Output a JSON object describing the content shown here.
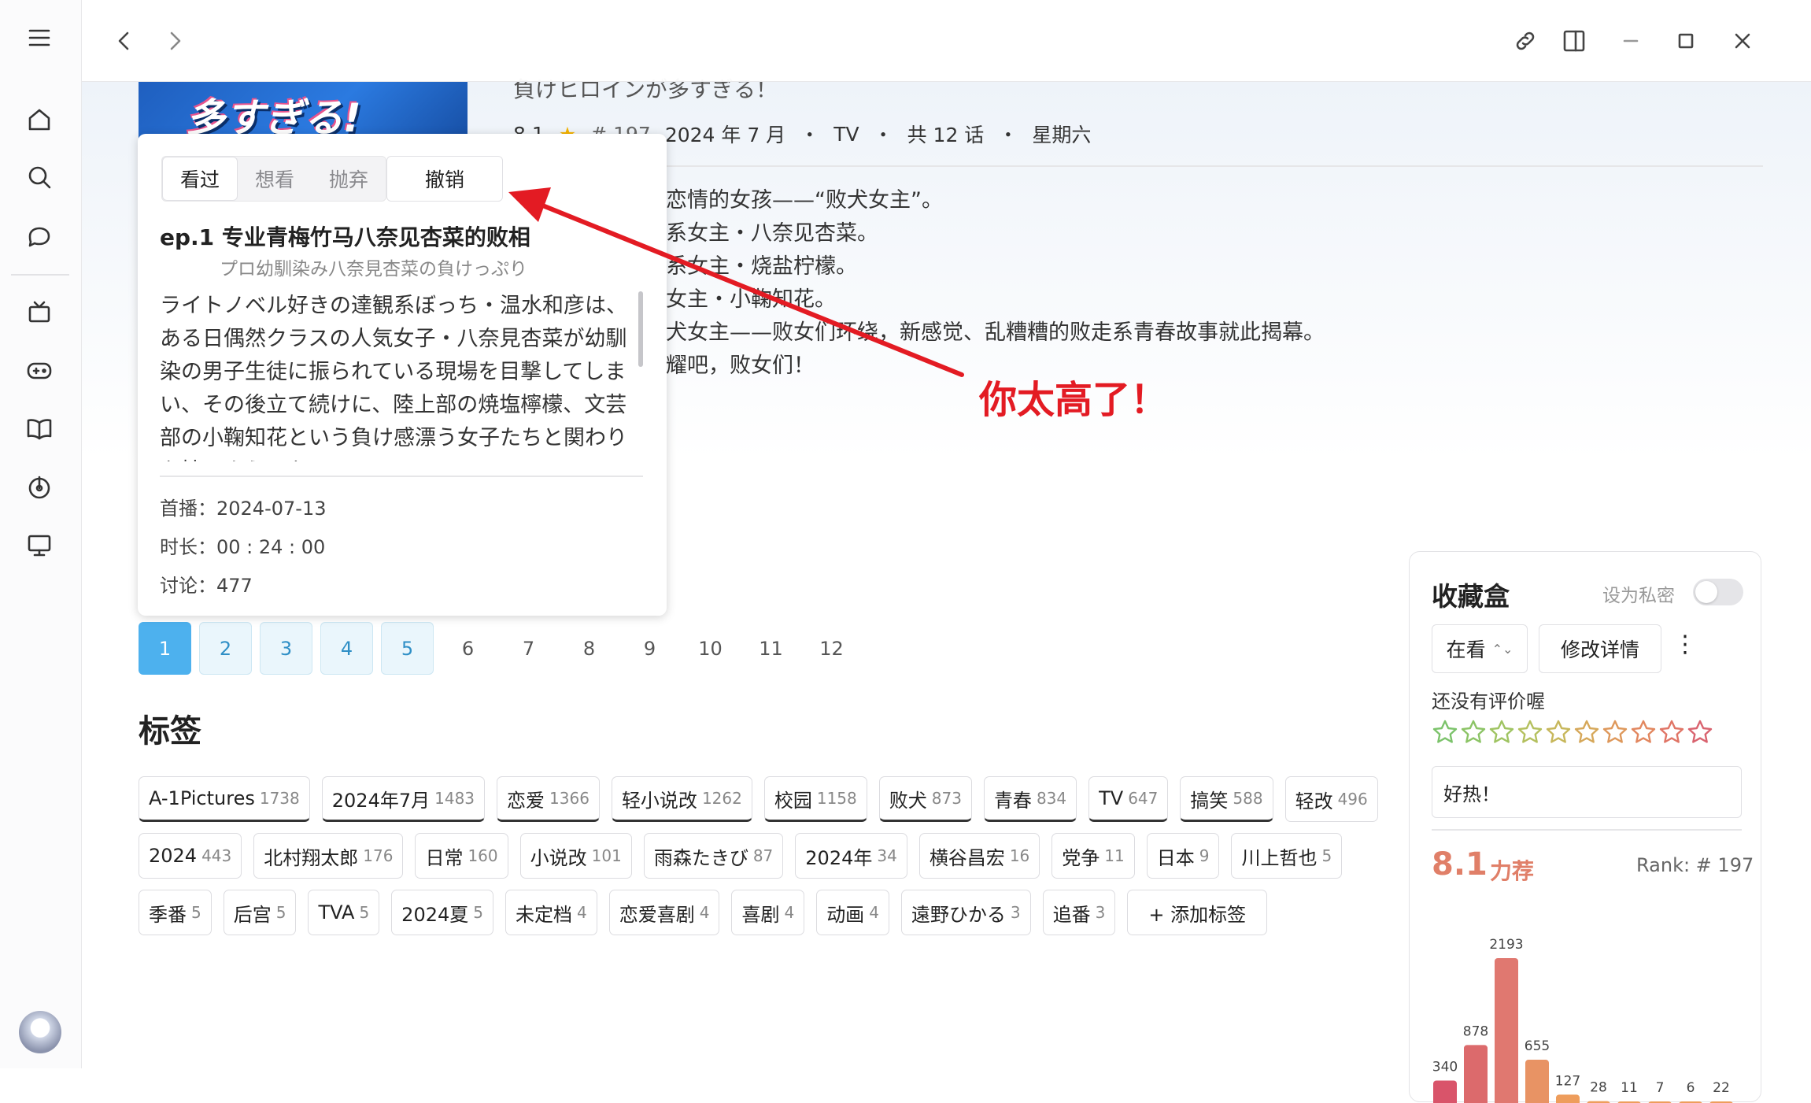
{
  "hero": {
    "title_cut": "負けヒロインが多すぎる！",
    "cover_text": "多すぎる!",
    "score": "8.1",
    "rank": "# 197",
    "meta": [
      "2024 年 7 月",
      "・",
      "TV",
      "・",
      "共 12 话",
      "・",
      "星期六"
    ]
  },
  "summary_lines": [
    "恋情的女孩——“败犬女主”。",
    "系女主・八奈见杏菜。",
    "系女主・烧盐柠檬。",
    "女主・小鞠知花。",
    "犬女主——败女们环绕，新感觉、乱糟糟的败走系青春故事就此揭幕。",
    "耀吧，败女们！"
  ],
  "popup": {
    "tabs": [
      "看过",
      "想看",
      "抛弃"
    ],
    "cancel": "撤销",
    "ep_title": "ep.1  专业青梅竹马八奈见杏菜的败相",
    "ep_subtitle": "プロ幼馴染み八奈見杏菜の負けっぷり",
    "ep_desc": "ライトノベル好きの達観系ぼっち・温水和彦は、ある日偶然クラスの人気女子・八奈見杏菜が幼馴染の男子生徒に振られている現場を目撃してしまい、その後立て続けに、陸上部の焼塩檸檬、文芸部の小鞠知花という負け感漂う女子たちと関わりを持つようになる。",
    "air_label": "首播：",
    "air_date": "2024-07-13",
    "duration_label": "时长：",
    "duration": "00 : 24 : 00",
    "discuss_label": "讨论：",
    "discuss": "477"
  },
  "pager": [
    {
      "label": "1",
      "state": "current"
    },
    {
      "label": "2",
      "state": "watched"
    },
    {
      "label": "3",
      "state": "watched"
    },
    {
      "label": "4",
      "state": "watched"
    },
    {
      "label": "5",
      "state": "watched"
    },
    {
      "label": "6",
      "state": "none"
    },
    {
      "label": "7",
      "state": "none"
    },
    {
      "label": "8",
      "state": "none"
    },
    {
      "label": "9",
      "state": "none"
    },
    {
      "label": "10",
      "state": "none"
    },
    {
      "label": "11",
      "state": "none"
    },
    {
      "label": "12",
      "state": "none"
    }
  ],
  "tags_title": "标签",
  "tags": [
    {
      "name": "A-1Pictures",
      "count": "1738",
      "hot": true
    },
    {
      "name": "2024年7月",
      "count": "1483",
      "hot": true
    },
    {
      "name": "恋爱",
      "count": "1366",
      "hot": true
    },
    {
      "name": "轻小说改",
      "count": "1262",
      "hot": true
    },
    {
      "name": "校园",
      "count": "1158",
      "hot": true
    },
    {
      "name": "败犬",
      "count": "873",
      "hot": true
    },
    {
      "name": "青春",
      "count": "834",
      "hot": true
    },
    {
      "name": "TV",
      "count": "647",
      "hot": true
    },
    {
      "name": "搞笑",
      "count": "588",
      "hot": true
    },
    {
      "name": "轻改",
      "count": "496",
      "hot": false
    },
    {
      "name": "2024",
      "count": "443",
      "hot": false
    },
    {
      "name": "北村翔太郎",
      "count": "176",
      "hot": false
    },
    {
      "name": "日常",
      "count": "160",
      "hot": false
    },
    {
      "name": "小说改",
      "count": "101",
      "hot": false
    },
    {
      "name": "雨森たきび",
      "count": "87",
      "hot": false
    },
    {
      "name": "2024年",
      "count": "34",
      "hot": false
    },
    {
      "name": "横谷昌宏",
      "count": "16",
      "hot": false
    },
    {
      "name": "党争",
      "count": "11",
      "hot": false
    },
    {
      "name": "日本",
      "count": "9",
      "hot": false
    },
    {
      "name": "川上哲也",
      "count": "5",
      "hot": false
    },
    {
      "name": "季番",
      "count": "5",
      "hot": false
    },
    {
      "name": "后宫",
      "count": "5",
      "hot": false
    },
    {
      "name": "TVA",
      "count": "5",
      "hot": false
    },
    {
      "name": "2024夏",
      "count": "5",
      "hot": false
    },
    {
      "name": "未定档",
      "count": "4",
      "hot": false
    },
    {
      "name": "恋爱喜剧",
      "count": "4",
      "hot": false
    },
    {
      "name": "喜剧",
      "count": "4",
      "hot": false
    },
    {
      "name": "动画",
      "count": "4",
      "hot": false
    },
    {
      "name": "遠野ひかる",
      "count": "3",
      "hot": false
    },
    {
      "name": "追番",
      "count": "3",
      "hot": false
    }
  ],
  "add_tag": "+ 添加标签",
  "collection": {
    "title": "收藏盒",
    "private_label": "设为私密",
    "status": "在看",
    "edit": "修改详情",
    "more": "⋮",
    "no_rating": "还没有评价喔",
    "comment": "好热！",
    "score": "8.1",
    "score_word": "力荐",
    "rank": "Rank: # 197",
    "star_colors": [
      "#7cc36b",
      "#8cc466",
      "#9fc462",
      "#b4c05e",
      "#c7b75b",
      "#d6a85a",
      "#de985b",
      "#e2875f",
      "#e07566",
      "#d9636f"
    ]
  },
  "histogram": {
    "type": "bar",
    "values": [
      340,
      878,
      2193,
      655,
      127,
      28,
      11,
      7,
      6,
      22
    ],
    "colors": [
      "#d9546a",
      "#dc6a6c",
      "#e07870",
      "#e89364",
      "#ee9d5c",
      "#ee9d5c",
      "#ee9d5c",
      "#ee9d5c",
      "#ee9d5c",
      "#ee9d5c"
    ]
  },
  "annotation": {
    "text": "你太高了！",
    "color": "#e31b23"
  },
  "icons": {
    "menu": "menu-icon",
    "home": "home-icon",
    "search": "search-icon",
    "chat": "chat-icon",
    "tv": "tv-icon",
    "game": "gamepad-icon",
    "book": "book-icon",
    "music": "music-icon",
    "monitor": "monitor-icon",
    "back": "chevron-left-icon",
    "forward": "chevron-right-icon",
    "link": "link-icon",
    "panel": "panel-icon",
    "minimize": "minimize-icon",
    "maximize": "maximize-icon",
    "close": "close-icon"
  }
}
